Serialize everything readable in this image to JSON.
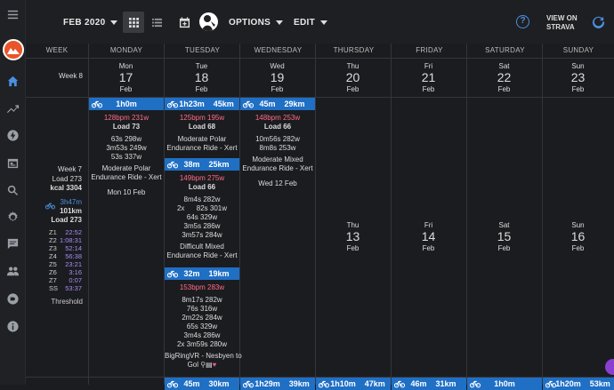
{
  "toolbar": {
    "month": "FEB 2020",
    "options": "OPTIONS",
    "edit": "EDIT",
    "view_on_strava_1": "VIEW ON",
    "view_on_strava_2": "STRAVA"
  },
  "sidebar_icons": [
    "menu-icon",
    "logo",
    "home-icon",
    "trending-icon",
    "power-icon",
    "calendar-icon",
    "search-icon",
    "settings-icon",
    "chat-icon",
    "people-icon",
    "discord-icon",
    "info-icon"
  ],
  "columns": [
    "WEEK",
    "MONDAY",
    "TUESDAY",
    "WEDNESDAY",
    "THURSDAY",
    "FRIDAY",
    "SATURDAY",
    "SUNDAY"
  ],
  "week8": {
    "label": "Week 8",
    "days": [
      {
        "name": "Mon",
        "date": "17",
        "month": "Feb"
      },
      {
        "name": "Tue",
        "date": "18",
        "month": "Feb"
      },
      {
        "name": "Wed",
        "date": "19",
        "month": "Feb"
      },
      {
        "name": "Thu",
        "date": "20",
        "month": "Feb"
      },
      {
        "name": "Fri",
        "date": "21",
        "month": "Feb"
      },
      {
        "name": "Sat",
        "date": "22",
        "month": "Feb"
      },
      {
        "name": "Sun",
        "date": "23",
        "month": "Feb"
      }
    ]
  },
  "week7": {
    "label": "Week 7",
    "load": "Load 273",
    "kcal": "kcal 3304",
    "time": "3h47m",
    "dist": "101km",
    "load2": "Load 273",
    "zones": [
      {
        "z": "Z1",
        "v": "22:52"
      },
      {
        "z": "Z2",
        "v": "1:08:31"
      },
      {
        "z": "Z3",
        "v": "52:14"
      },
      {
        "z": "Z4",
        "v": "56:38"
      },
      {
        "z": "Z5",
        "v": "23:21"
      },
      {
        "z": "Z6",
        "v": "3:16"
      },
      {
        "z": "Z7",
        "v": "0:07"
      },
      {
        "z": "SS",
        "v": "53:37"
      }
    ],
    "threshold": "Threshold",
    "later_days": [
      {
        "name": "Thu",
        "date": "13",
        "month": "Feb"
      },
      {
        "name": "Fri",
        "date": "14",
        "month": "Feb"
      },
      {
        "name": "Sat",
        "date": "15",
        "month": "Feb"
      },
      {
        "name": "Sun",
        "date": "16",
        "month": "Feb"
      }
    ]
  },
  "mon": {
    "bar": {
      "time": "1h0m",
      "dist": ""
    },
    "hr": "128bpm",
    "pw": "231w",
    "load": "Load 73",
    "l1": "63s 298w",
    "l2": "3m53s 249w",
    "l3": "53s 337w",
    "n1": "Moderate Polar",
    "n2": "Endurance Ride - Xert",
    "date": "Mon 10 Feb"
  },
  "tue1": {
    "bar": {
      "time": "1h23m",
      "dist": "45km"
    },
    "hr": "125bpm",
    "pw": "195w",
    "load": "Load 68",
    "n1": "Moderate Polar",
    "n2": "Endurance Ride - Xert"
  },
  "tue2": {
    "bar": {
      "time": "38m",
      "dist": "25km"
    },
    "hr": "149bpm",
    "pw": "275w",
    "load": "Load 66",
    "l1": "8m4s 282w",
    "l2": "2x      82s 301w",
    "l3": "64s 329w",
    "l4": "3m5s 286w",
    "l5": "3m57s 284w",
    "n1": "Difficult Mixed",
    "n2": "Endurance Ride - Xert"
  },
  "tue3": {
    "bar": {
      "time": "32m",
      "dist": "19km"
    },
    "hr": "153bpm",
    "pw": "283w",
    "l1": "8m17s 282w",
    "l2": "76s 316w",
    "l3": "2m22s 284w",
    "l4": "65s 329w",
    "l5": "3m4s 286w",
    "l6": "2x 3m59s 280w",
    "n1": "BigRingVR - Nesbyen to",
    "n2": "Gol"
  },
  "wed": {
    "bar": {
      "time": "45m",
      "dist": "29km"
    },
    "hr": "148bpm",
    "pw": "253w",
    "load": "Load 66",
    "l1": "10m56s 282w",
    "l2": "8m8s 253w",
    "n1": "Moderate Mixed",
    "n2": "Endurance Ride - Xert",
    "date": "Wed 12 Feb"
  },
  "bottom_bars": [
    {
      "time": "45m",
      "dist": "30km"
    },
    {
      "time": "1h29m",
      "dist": "39km"
    },
    {
      "time": "1h10m",
      "dist": "47km"
    },
    {
      "time": "46m",
      "dist": "31km"
    },
    {
      "time": "1h0m",
      "dist": ""
    },
    {
      "time": "1h20m",
      "dist": "53km"
    }
  ]
}
